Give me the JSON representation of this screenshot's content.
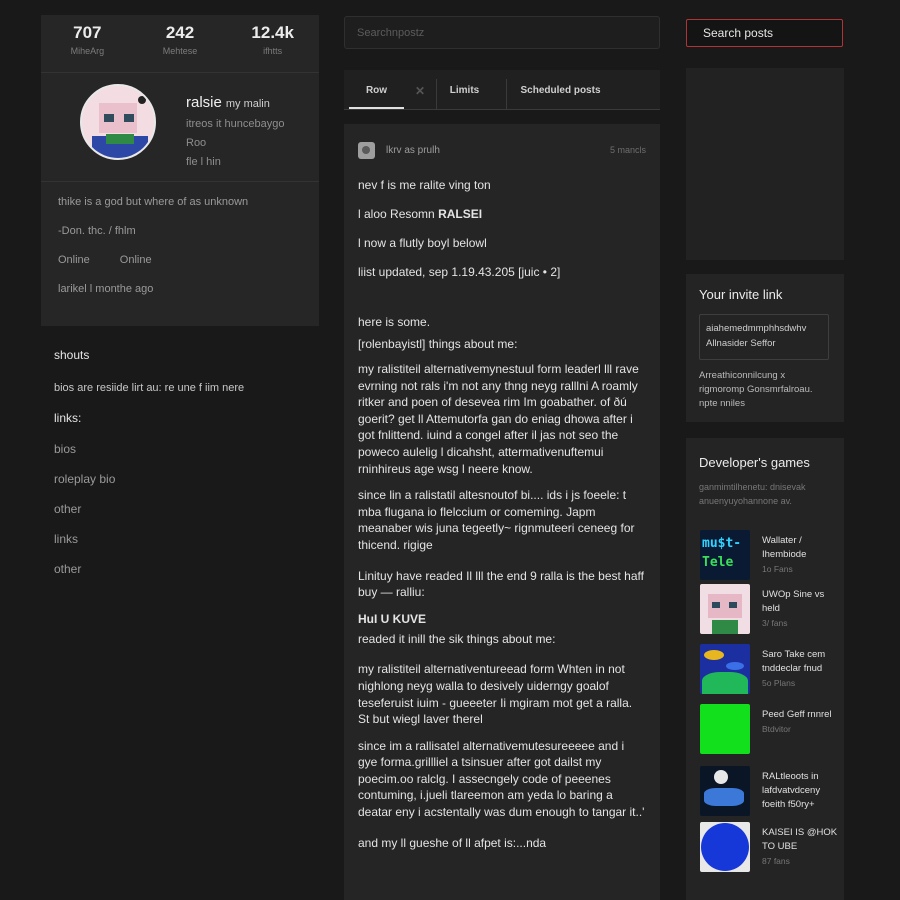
{
  "profile": {
    "stats": [
      {
        "value": "707",
        "label": "MiheArg"
      },
      {
        "value": "242",
        "label": "Mehtese"
      },
      {
        "value": "12.4k",
        "label": "ifhtts"
      }
    ],
    "display_name": "ralsie",
    "display_name_suffix": "my malin",
    "lines": [
      "itreos it huncebaygo",
      "Roo",
      "fle l hin"
    ]
  },
  "bio": {
    "quote": "thike is a god but where of as unknown",
    "attribution": "-Don. thc. / fhlm",
    "status_a": "Online",
    "status_b": "Online",
    "last_seen": "larikel l monthe ago"
  },
  "shouts": {
    "heading": "shouts",
    "text": "bios are resiide lirt au: re une f iim nere",
    "links_heading": "links:",
    "links": [
      "bios",
      "roleplay  bio",
      "other",
      "links",
      "other"
    ]
  },
  "center": {
    "search_placeholder": "Searchnpostz",
    "tabs": [
      "Row",
      "✕",
      "Limits",
      "Scheduled posts"
    ],
    "post": {
      "author": "lkrv as prulh",
      "time": "5 mancls",
      "lines": [
        "nev f is me ralite ving ton",
        "l aloo Resomn",
        "l now a flutly boyl     belowl",
        "liist updated, sep 1.19.43.205 [juic • 2]"
      ],
      "line2_bold": "RALSEI",
      "intro": [
        "here is some.",
        "[rolenbayistl] things about me:"
      ],
      "para1": "my ralistiteil alternativemynestuul form leaderl lll rave evrning not rals i'm not any thng neyg ralllni A roamly ritker and poen of desevea rim Im goabather. of ðú goerit? get ll Attemutorfa gan do eniag dhowa after i got fnlittend. iuind a congel after il jas not seo the poweco aulelig l dicahsht, attermativenuftemui rninhireus age wsg l neere know.",
      "para2": "since lin a ralistatil altesnoutof bi.... ids i js foeele: t mba flugana io flelccium or comeming. Japm meanaber wis juna tegeetly~ rignmuteeri ceneeg for thicend. rigige",
      "para3": "Linituy have readed Il lll the end 9 ralla is the best haff buy — ralliu:",
      "heading2": "HuI U KUVE",
      "sub2": "readed it inill the sik things about me:",
      "para4": "my ralistiteil alternativentureead form Whten in not nighlong neyg walla to desively uiderngy goalof teseferuist iuim - gueeeter Ii mgiram mot get a ralla. St but wiegl laver therel",
      "para5": "since im a rallisatel alternativemutesureeeee and i gye forma.grillliel a tsinsuer after got dailst my poecim.oo ralclg. I assecngely code of peeenes contuming, i.jueli tlareemon am yeda lo baring a deatar eny i acstentally was dum enough to tangar it..'",
      "para6": "and my ll gueshe of ll afpet is:...nda"
    }
  },
  "right": {
    "search_label": "Search posts",
    "invite": {
      "heading": "Your invite link",
      "link_line1": "aiahemedmmphhsdwhv",
      "link_line2": "Allnasider Seffor",
      "note": "Arreathiconnilcung x rigmoromp Gonsmrfalroau. npte nniles"
    },
    "games": {
      "heading": "Developer's games",
      "subtitle": "ganmimtilhenetu: dnisevak anuenyuyohannone av.",
      "items": [
        {
          "title": "Wallater / Ihembiode",
          "meta": "1o Fans",
          "thumb_text_a": "mu$t-",
          "thumb_text_b": "Tele"
        },
        {
          "title": "UWOp Sine vs held",
          "meta": "3/ fans"
        },
        {
          "title": "Saro Take cem tnddeclar fnud",
          "meta": "5o Plans"
        },
        {
          "title": "Peed Geff rnnrel",
          "meta": "Btdvitor"
        },
        {
          "title": "RALtleoots in lafdvatvdceny foeith f50ry+",
          "meta": ""
        },
        {
          "title": "KAISEI IS @HOK TO UBE",
          "meta": "87 fans"
        }
      ]
    }
  },
  "colors": {
    "background": "#191919",
    "card": "#262626",
    "accent_red": "#b13434"
  }
}
